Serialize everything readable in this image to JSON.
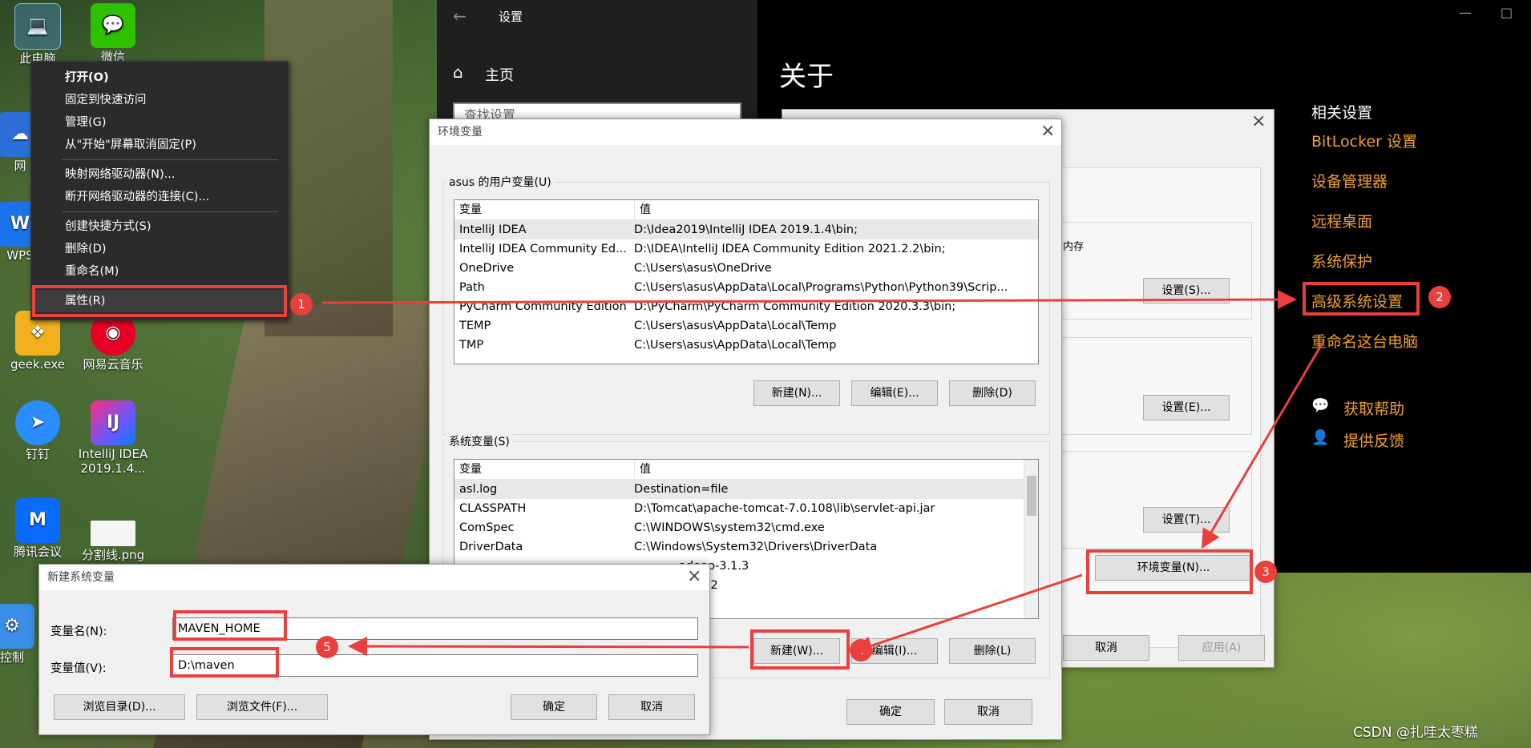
{
  "desktop": {
    "icons": [
      {
        "label": "此电脑"
      },
      {
        "label": "微信"
      },
      {
        "label": "网"
      },
      {
        "label": "WPS"
      },
      {
        "label": "geek.exe"
      },
      {
        "label": "网易云音乐"
      },
      {
        "label": "钉钉"
      },
      {
        "label": "IntelliJ IDEA 2019.1.4..."
      },
      {
        "label": "腾讯会议"
      },
      {
        "label": "分割线.png"
      },
      {
        "label": "控制"
      }
    ]
  },
  "context_menu": {
    "items": [
      {
        "label": "打开(O)"
      },
      {
        "label": "固定到快速访问"
      },
      {
        "label": "管理(G)"
      },
      {
        "label": "从\"开始\"屏幕取消固定(P)"
      },
      {
        "label": "映射网络驱动器(N)..."
      },
      {
        "label": "断开网络驱动器的连接(C)..."
      },
      {
        "label": "创建快捷方式(S)"
      },
      {
        "label": "删除(D)"
      },
      {
        "label": "重命名(M)"
      },
      {
        "label": "属性(R)"
      }
    ]
  },
  "settings": {
    "window_title": "设置",
    "home_label": "主页",
    "search_placeholder": "查找设置",
    "page_title": "关于",
    "related_heading": "相关设置",
    "related_links": [
      {
        "label": "BitLocker 设置"
      },
      {
        "label": "设备管理器"
      },
      {
        "label": "远程桌面"
      },
      {
        "label": "系统保护"
      },
      {
        "label": "高级系统设置"
      },
      {
        "label": "重命名这台电脑"
      }
    ],
    "help_label": "获取帮助",
    "feedback_label": "提供反馈"
  },
  "sysprops": {
    "memory_text": "内存",
    "btn_settings_s": "设置(S)...",
    "btn_settings_e": "设置(E)...",
    "btn_settings_t": "设置(T)...",
    "btn_env": "环境变量(N)...",
    "btn_cancel": "取消",
    "btn_apply": "应用(A)"
  },
  "envdlg": {
    "title": "环境变量",
    "user_group_label": "asus 的用户变量(U)",
    "col_var": "变量",
    "col_val": "值",
    "user_vars": [
      {
        "name": "IntelliJ IDEA",
        "value": "D:\\Idea2019\\IntelliJ IDEA 2019.1.4\\bin;"
      },
      {
        "name": "IntelliJ IDEA Community Ed...",
        "value": "D:\\IDEA\\IntelliJ IDEA Community Edition 2021.2.2\\bin;"
      },
      {
        "name": "OneDrive",
        "value": "C:\\Users\\asus\\OneDrive"
      },
      {
        "name": "Path",
        "value": "C:\\Users\\asus\\AppData\\Local\\Programs\\Python\\Python39\\Scrip..."
      },
      {
        "name": "PyCharm Community Edition",
        "value": "D:\\PyCharm\\PyCharm Community Edition 2020.3.3\\bin;"
      },
      {
        "name": "TEMP",
        "value": "C:\\Users\\asus\\AppData\\Local\\Temp"
      },
      {
        "name": "TMP",
        "value": "C:\\Users\\asus\\AppData\\Local\\Temp"
      }
    ],
    "user_btn_new": "新建(N)...",
    "user_btn_edit": "编辑(E)...",
    "user_btn_delete": "删除(D)",
    "sys_group_label": "系统变量(S)",
    "sys_vars": [
      {
        "name": "asl.log",
        "value": "Destination=file"
      },
      {
        "name": "CLASSPATH",
        "value": "D:\\Tomcat\\apache-tomcat-7.0.108\\lib\\servlet-api.jar"
      },
      {
        "name": "ComSpec",
        "value": "C:\\WINDOWS\\system32\\cmd.exe"
      },
      {
        "name": "DriverData",
        "value": "C:\\Windows\\System32\\Drivers\\DriverData"
      }
    ],
    "sys_partial_1": "adoop-3.1.3",
    "sys_partial_2": ".0_212",
    "sys_btn_new": "新建(W)...",
    "sys_btn_edit": "编辑(I)...",
    "sys_btn_delete": "删除(L)",
    "btn_ok": "确定",
    "btn_cancel": "取消"
  },
  "newvar": {
    "title": "新建系统变量",
    "name_label": "变量名(N):",
    "name_value": "MAVEN_HOME",
    "value_label": "变量值(V):",
    "value_value": "D:\\maven",
    "btn_browse_dir": "浏览目录(D)...",
    "btn_browse_file": "浏览文件(F)...",
    "btn_ok": "确定",
    "btn_cancel": "取消"
  },
  "annotations": {
    "step1": "1",
    "step2": "2",
    "step3": "3",
    "step4": "4",
    "step5": "5",
    "color": "#e8403c"
  },
  "watermark": "CSDN @扎哇太枣糕"
}
